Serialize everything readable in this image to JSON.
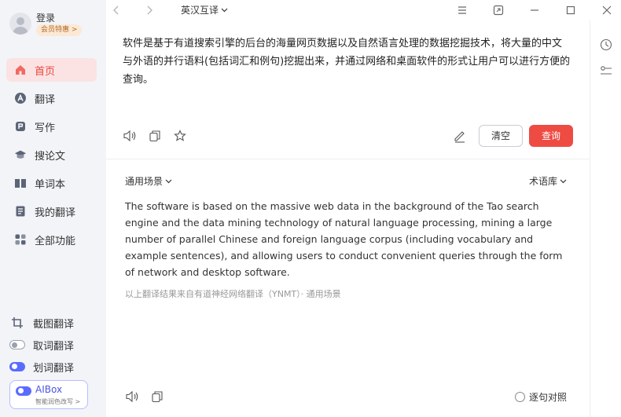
{
  "profile": {
    "login_label": "登录",
    "vip_label": "会员特惠 >"
  },
  "nav": {
    "items": [
      {
        "label": "首页",
        "icon": "home-icon",
        "active": true
      },
      {
        "label": "翻译",
        "icon": "translate-icon"
      },
      {
        "label": "写作",
        "icon": "writing-icon"
      },
      {
        "label": "搜论文",
        "icon": "graduation-cap-icon"
      },
      {
        "label": "单词本",
        "icon": "book-icon"
      },
      {
        "label": "我的翻译",
        "icon": "document-icon"
      },
      {
        "label": "全部功能",
        "icon": "grid-icon"
      }
    ]
  },
  "tools": {
    "screenshot_translate": "截图翻译",
    "word_pick": "取词翻译",
    "selection_translate": "划词翻译"
  },
  "aibox": {
    "title": "AIBox",
    "subtitle": "智能润色改写 >"
  },
  "topbar": {
    "lang_pair": "英汉互译"
  },
  "source": {
    "text": "软件是基于有道搜索引擎的后台的海量网页数据以及自然语言处理的数据挖掘技术，将大量的中文与外语的并行语料(包括词汇和例句)挖掘出来，并通过网络和桌面软件的形式让用户可以进行方便的查询。",
    "clear_label": "清空",
    "query_label": "查询"
  },
  "result": {
    "scene_label": "通用场景",
    "termbase_label": "术语库",
    "text": "The software is based on the massive web data in the background of the Tao search engine and the data mining technology of natural language processing, mining a large number of parallel Chinese and foreign language corpus (including vocabulary and example sentences), and allowing users to conduct convenient queries through the form of network and desktop software.",
    "source_note": "以上翻译结果来自有道神经网络翻译（YNMT）· 通用场景",
    "sentence_compare_label": "逐句对照"
  },
  "colors": {
    "accent": "#ee4b43",
    "sidebar_bg": "#f3f4f8",
    "active_bg": "#fbe3e3",
    "aibox_accent": "#5b6bff"
  }
}
